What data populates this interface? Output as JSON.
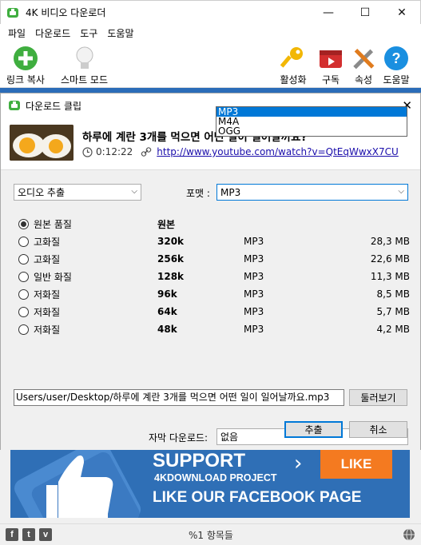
{
  "window": {
    "title": "4K 비디오 다운로더",
    "minimize": "—",
    "maximize": "☐",
    "close": "✕"
  },
  "menu": [
    "파일",
    "다운로드",
    "도구",
    "도움말"
  ],
  "toolbar": {
    "paste_link": "링크 복사",
    "smart_mode": "스마트 모드",
    "activate": "활성화",
    "subscribe": "구독",
    "preferences": "속성",
    "help": "도움말"
  },
  "dialog": {
    "title": "다운로드 클립",
    "close": "✕",
    "video_title": "하루에 계란 3개를 먹으면 어떤 일이 일어날까요?",
    "duration": "0:12:22",
    "url": "http://www.youtube.com/watch?v=QtEqWwxX7CU",
    "mode_select": "오디오 추출",
    "format_label": "포맷 :",
    "format_value": "MP3",
    "format_options": [
      "MP3",
      "M4A",
      "OGG"
    ],
    "selected_format_option": 0,
    "quality_rows": [
      {
        "name": "원본 품질",
        "bitrate": "원본",
        "format": "",
        "size": "",
        "selected": true
      },
      {
        "name": "고화질",
        "bitrate": "320k",
        "format": "MP3",
        "size": "28,3 MB",
        "selected": false
      },
      {
        "name": "고화질",
        "bitrate": "256k",
        "format": "MP3",
        "size": "22,6 MB",
        "selected": false
      },
      {
        "name": "일반 화질",
        "bitrate": "128k",
        "format": "MP3",
        "size": "11,3 MB",
        "selected": false
      },
      {
        "name": "저화질",
        "bitrate": "96k",
        "format": "MP3",
        "size": "8,5 MB",
        "selected": false
      },
      {
        "name": "저화질",
        "bitrate": "64k",
        "format": "MP3",
        "size": "5,7 MB",
        "selected": false
      },
      {
        "name": "저화질",
        "bitrate": "48k",
        "format": "MP3",
        "size": "4,2 MB",
        "selected": false
      }
    ],
    "subtitle_label": "자막 다운로드:",
    "subtitle_value": "없음",
    "save_path": "Users/user/Desktop/하루에 계란 3개를 먹으면 어떤 일이 일어날까요.mp3",
    "browse_button": "둘러보기",
    "extract_button": "추출",
    "cancel_button": "취소"
  },
  "banner": {
    "headline": "SUPPORT",
    "chevron": "›",
    "project": "4KDOWNLOAD PROJECT",
    "like": "LIKE",
    "tagline": "LIKE OUR FACEBOOK PAGE"
  },
  "status": {
    "items": "%1 항목들",
    "social": [
      "f",
      "t",
      "v"
    ]
  },
  "colors": {
    "accent": "#0078d7",
    "banner_bg": "#2f6fb6",
    "banner_like": "#f47a20",
    "paste_green": "#3fae3f",
    "help_blue": "#1a8fe0",
    "subscribe_red": "#d32f2f"
  }
}
